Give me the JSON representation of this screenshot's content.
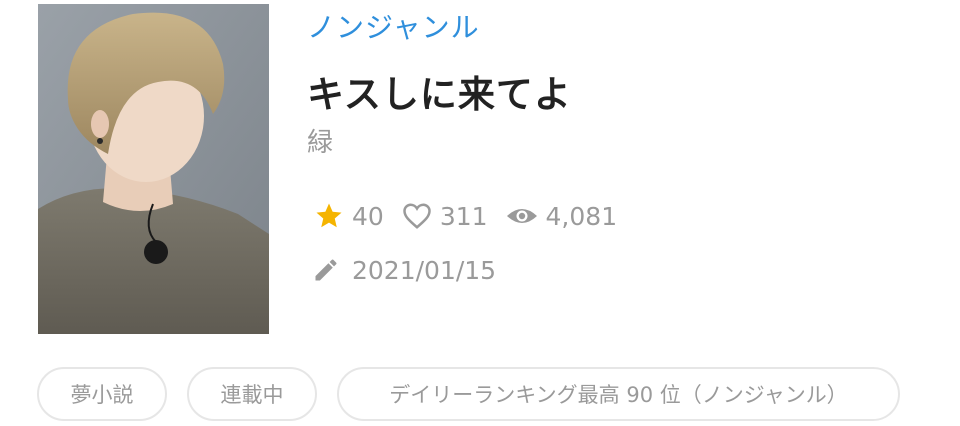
{
  "novel": {
    "genre": "ノンジャンル",
    "title": "キスしに来てよ",
    "author": "緑",
    "cover_alt": "cover-image",
    "stats": {
      "stars": "40",
      "likes": "311",
      "views": "4,081"
    },
    "updated_date": "2021/01/15",
    "tags": [
      {
        "label": "夢小説"
      },
      {
        "label": "連載中"
      },
      {
        "label": "デイリーランキング最高 90 位（ノンジャンル）"
      }
    ]
  },
  "colors": {
    "genre_link": "#2f8fdc",
    "star": "#f5b400",
    "meta_text": "#9a9a9a",
    "title_text": "#222222",
    "tag_border": "#e6e6e6"
  },
  "icons": {
    "star": "star-icon",
    "heart": "heart-icon",
    "views": "eye-icon",
    "date": "pencil-icon"
  }
}
